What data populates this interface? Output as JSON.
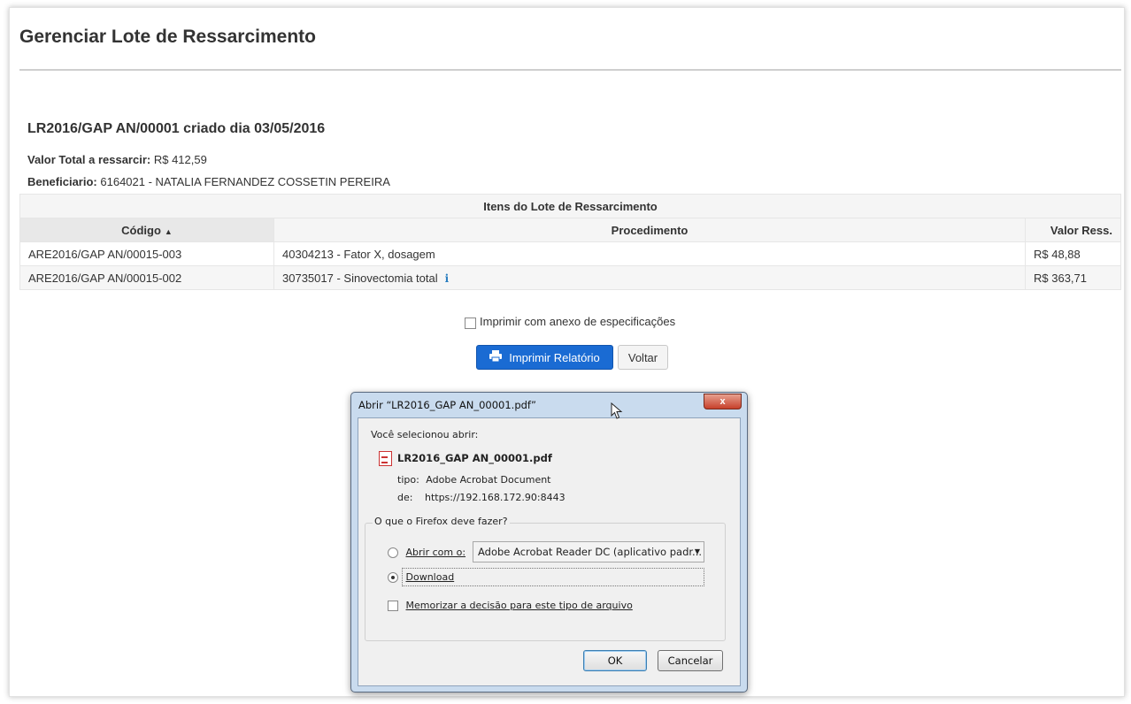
{
  "page": {
    "title": "Gerenciar Lote de Ressarcimento"
  },
  "lote": {
    "heading": "LR2016/GAP AN/00001 criado dia 03/05/2016",
    "total_label": "Valor Total a ressarcir:",
    "total_value": "R$ 412,59",
    "beneficiary_label": "Beneficiario:",
    "beneficiary_value": "6164021 - NATALIA FERNANDEZ COSSETIN PEREIRA"
  },
  "table": {
    "caption": "Itens do Lote de Ressarcimento",
    "columns": [
      "Código",
      "Procedimento",
      "Valor Ress."
    ],
    "rows": [
      {
        "codigo": "ARE2016/GAP AN/00015-003",
        "procedimento": "40304213 - Fator X, dosagem",
        "valor": "R$ 48,88"
      },
      {
        "codigo": "ARE2016/GAP AN/00015-002",
        "procedimento": "30735017 - Sinovectomia total",
        "valor": "R$ 363,71"
      }
    ]
  },
  "actions": {
    "print_annex_label": "Imprimir com anexo de especificações",
    "print_button": "Imprimir Relatório",
    "back_button": "Voltar"
  },
  "dialog": {
    "title": "Abrir “LR2016_GAP AN_00001.pdf”",
    "close_label": "x",
    "selected_label": "Você selecionou abrir:",
    "filename": "LR2016_GAP AN_00001.pdf",
    "type_label": "tipo:",
    "type_value": "Adobe Acrobat Document",
    "from_label": "de:",
    "from_value": "https://192.168.172.90:8443",
    "group_label": "O que o Firefox deve fazer?",
    "open_with_label": "Abrir com o:",
    "open_with_value": "Adobe Acrobat Reader DC  (aplicativo padr...",
    "download_label": "Download",
    "remember_label": "Memorizar a decisão para este tipo de arquivo",
    "ok_label": "OK",
    "cancel_label": "Cancelar"
  },
  "colors": {
    "primary_button": "#1a6bd3",
    "dialog_frame": "#c9dbee",
    "close_button": "#c7402b",
    "info_icon": "#2a7ec0"
  },
  "icons": {
    "sort": "sort-asc-icon",
    "info": "info-icon",
    "printer": "printer-icon",
    "pdf": "pdf-file-icon",
    "cursor": "mouse-cursor-icon"
  }
}
